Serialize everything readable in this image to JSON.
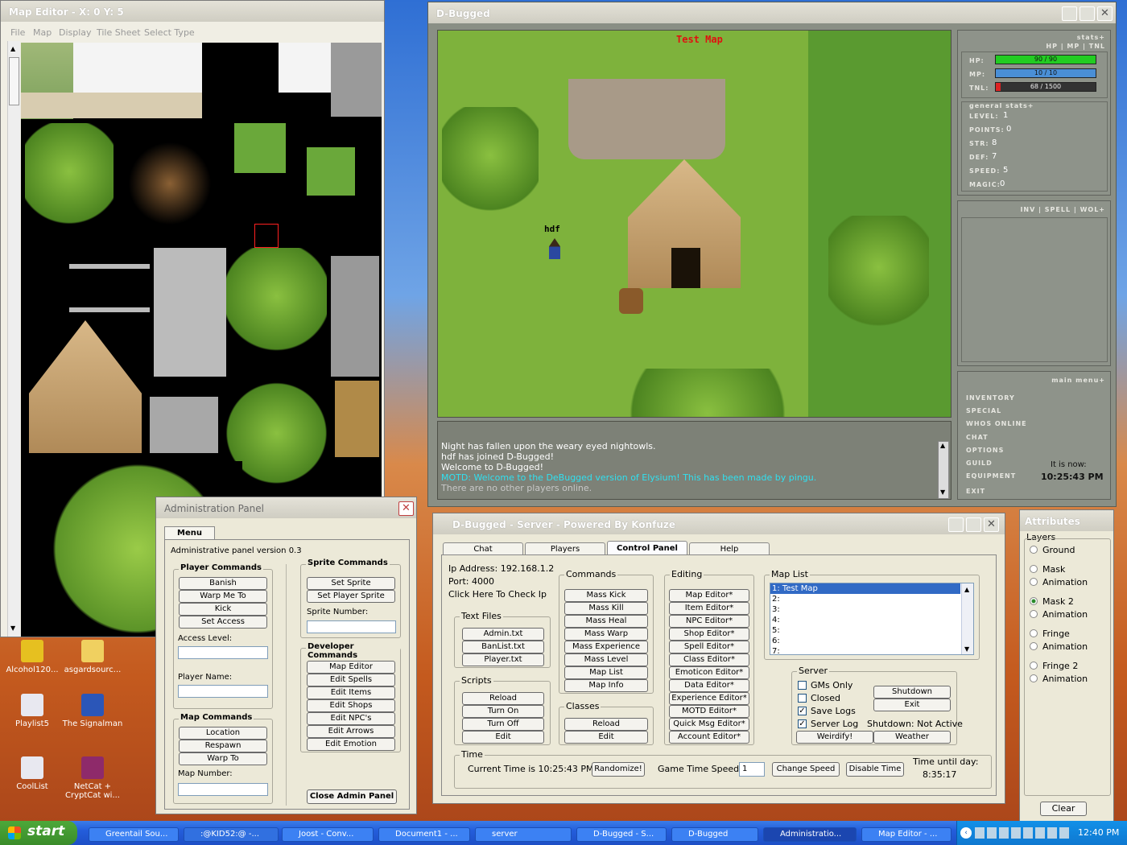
{
  "desktop": {
    "icons": [
      {
        "label": "Alcohol120..."
      },
      {
        "label": "asgardsourc..."
      },
      {
        "label": "Playlist5"
      },
      {
        "label": "The Signalman"
      },
      {
        "label": "CoolList"
      },
      {
        "label": "NetCat + CryptCat wi..."
      }
    ]
  },
  "map_editor": {
    "title": "Map Editor - X: 0 Y: 5",
    "menu": [
      "File",
      "Map",
      "Display",
      "Tile Sheet",
      "Select Type"
    ]
  },
  "game": {
    "title": "D-Bugged",
    "map_name": "Test Map",
    "player_name": "hdf",
    "chat": [
      {
        "text": "Night has fallen upon the weary eyed nightowls.",
        "color": "#ffffff"
      },
      {
        "text": "hdf has joined D-Bugged!",
        "color": "#ffffff"
      },
      {
        "text": "Welcome to D-Bugged!",
        "color": "#ffffff"
      },
      {
        "text": "MOTD: Welcome to the DeBugged version of Elysium! This has been made by pingu.",
        "color": "#30e0f0"
      },
      {
        "text": "There are no other players online.",
        "color": "#c8c8c8"
      }
    ],
    "stats_header": "stats+",
    "stats_tabs": "HP | MP | TNL",
    "hp": {
      "label": "HP:",
      "text": "90 / 90",
      "fraction": 1.0,
      "color": "#22cc22"
    },
    "mp": {
      "label": "MP:",
      "text": "10 / 10",
      "fraction": 1.0,
      "color": "#4a8fd6"
    },
    "tnl": {
      "label": "TNL:",
      "text": "68 / 1500",
      "fraction": 0.045,
      "color": "#dd2222"
    },
    "general_header": "general stats+",
    "general": [
      {
        "label": "LEVEL:",
        "value": "1"
      },
      {
        "label": "POINTS:",
        "value": "0"
      },
      {
        "label": "STR:",
        "value": "8"
      },
      {
        "label": "DEF:",
        "value": "7"
      },
      {
        "label": "SPEED:",
        "value": "5"
      },
      {
        "label": "MAGIC:",
        "value": "0"
      }
    ],
    "inv_tabs": "INV | SPELL | WOL+",
    "main_menu_header": "main menu+",
    "main_menu": [
      "INVENTORY",
      "SPECIAL",
      "WHOS ONLINE",
      "CHAT",
      "OPTIONS",
      "GUILD",
      "EQUIPMENT",
      "EXIT"
    ],
    "time_label": "It is now:",
    "time_value": "10:25:43 PM"
  },
  "admin": {
    "title": "Administration Panel",
    "tab": "Menu",
    "version": "Administrative panel version 0.3",
    "player_commands_title": "Player Commands",
    "player_commands": [
      "Banish",
      "Warp Me To",
      "Kick",
      "Set Access"
    ],
    "access_level_label": "Access Level:",
    "player_name_label": "Player Name:",
    "map_commands_title": "Map Commands",
    "map_commands": [
      "Location",
      "Respawn",
      "Warp To"
    ],
    "map_number_label": "Map Number:",
    "sprite_commands_title": "Sprite Commands",
    "sprite_commands": [
      "Set Sprite",
      "Set Player Sprite"
    ],
    "sprite_number_label": "Sprite Number:",
    "developer_commands_title": "Developer Commands",
    "developer_commands": [
      "Map Editor",
      "Edit Spells",
      "Edit Items",
      "Edit Shops",
      "Edit NPC's",
      "Edit Arrows",
      "Edit Emotion"
    ],
    "close_button": "Close Admin Panel"
  },
  "server": {
    "title": "D-Bugged - Server - Powered By Konfuze",
    "tabs": [
      "Chat",
      "Players",
      "Control Panel",
      "Help"
    ],
    "active_tab": "Control Panel",
    "ip": "Ip Address: 192.168.1.2",
    "port": "Port:  4000",
    "check_ip": "Click Here To Check Ip",
    "text_files_title": "Text Files",
    "text_files": [
      "Admin.txt",
      "BanList.txt",
      "Player.txt"
    ],
    "scripts_title": "Scripts",
    "scripts": [
      "Reload",
      "Turn On",
      "Turn Off",
      "Edit"
    ],
    "commands_title": "Commands",
    "commands": [
      "Mass Kick",
      "Mass Kill",
      "Mass Heal",
      "Mass Warp",
      "Mass Experience",
      "Mass Level",
      "Map List",
      "Map Info"
    ],
    "classes_title": "Classes",
    "classes": [
      "Reload",
      "Edit"
    ],
    "editing_title": "Editing",
    "editing": [
      "Map Editor*",
      "Item Editor*",
      "NPC Editor*",
      "Shop Editor*",
      "Spell Editor*",
      "Class Editor*",
      "Emoticon Editor*",
      "Data Editor*",
      "Experience Editor*",
      "MOTD Editor*",
      "Quick Msg Editor*",
      "Account Editor*"
    ],
    "map_list_title": "Map List",
    "map_list": [
      "1: Test Map",
      "2:",
      "3:",
      "4:",
      "5:",
      "6:",
      "7:"
    ],
    "server_group_title": "Server",
    "checks": [
      {
        "label": "GMs Only",
        "checked": false
      },
      {
        "label": "Closed",
        "checked": false
      },
      {
        "label": "Save Logs",
        "checked": true
      },
      {
        "label": "Server Log",
        "checked": true
      }
    ],
    "shutdown_button": "Shutdown",
    "exit_button": "Exit",
    "shutdown_status": "Shutdown: Not Active",
    "weirdify_button": "Weirdify!",
    "weather_button": "Weather",
    "time_title": "Time",
    "current_time": "Current Time is 10:25:43 PM",
    "randomize_button": "Randomize!",
    "game_speed_label": "Game Time Speed:",
    "game_speed_value": "1",
    "change_speed_button": "Change Speed",
    "disable_time_button": "Disable Time",
    "time_until_label": "Time until day:",
    "time_until_value": "8:35:17"
  },
  "attributes": {
    "title": "Attributes",
    "layers_label": "Layers",
    "layers": [
      {
        "label": "Ground",
        "selected": false
      },
      {
        "label": "Mask",
        "selected": false
      },
      {
        "label": "Animation",
        "selected": false
      },
      {
        "label": "Mask 2",
        "selected": true
      },
      {
        "label": "Animation",
        "selected": false
      },
      {
        "label": "Fringe",
        "selected": false
      },
      {
        "label": "Animation",
        "selected": false
      },
      {
        "label": "Fringe 2",
        "selected": false
      },
      {
        "label": "Animation",
        "selected": false
      }
    ],
    "clear_button": "Clear"
  },
  "taskbar": {
    "start": "start",
    "items": [
      "Greentail Sou...",
      ":@KID52:@ -...",
      "Joost - Conv...",
      "Document1 - ...",
      "server",
      "D-Bugged - S...",
      "D-Bugged",
      "Administratio...",
      "Map Editor - ..."
    ],
    "clock": "12:40 PM"
  }
}
